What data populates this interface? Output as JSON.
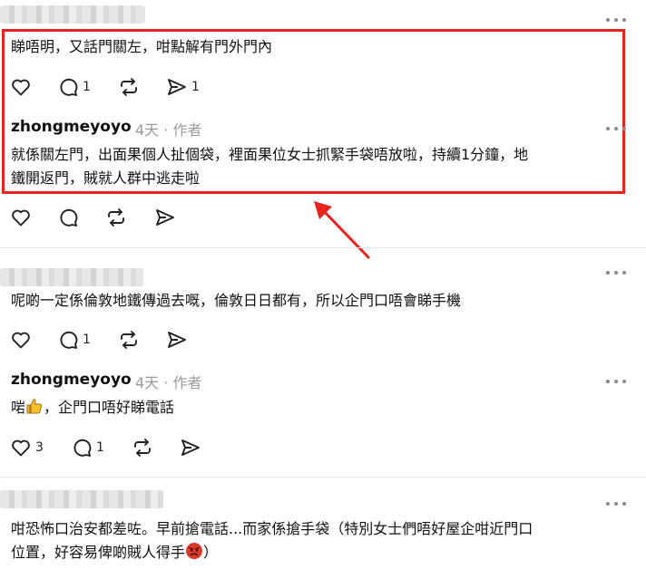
{
  "colors": {
    "highlight": "#e8221c",
    "arrow": "#e8221c",
    "icon": "#222222",
    "meta": "#9a9a9a"
  },
  "icons": {
    "like": "heart-icon",
    "reply": "comment-icon",
    "repost": "repost-icon",
    "share": "send-icon",
    "more": "more-dots-icon"
  },
  "thread1": {
    "reply1": {
      "text": "睇唔明，又話門關左，咁點解有門外門內",
      "reply_count": "1"
    },
    "reply2": {
      "author": "zhongmeyoyo",
      "time": "4天",
      "separator": "·",
      "role": "作者",
      "text_line1": "就係關左門，出面果個人扯個袋，裡面果位女士抓緊手袋唔放啦，持續1分鐘，地",
      "text_line2": "鐵開返門，賊就人群中逃走啦"
    }
  },
  "thread2": {
    "reply1": {
      "text": "呢啲一定係倫敦地鐵傳過去嘅，倫敦日日都有，所以企門口唔會睇手機",
      "reply_count": "1"
    },
    "reply2": {
      "author": "zhongmeyoyo",
      "time": "4天",
      "separator": "·",
      "role": "作者",
      "text_before": "啱",
      "text_after": "，企門口唔好睇電話",
      "like_count": "3",
      "reply_count": "1"
    }
  },
  "thread3": {
    "reply1": {
      "text_line1": "咁恐怖口治安都差咗。早前搶電話...而家係搶手袋（特別女士們唔好屋企咁近門口",
      "text_line2_before": "位置，好容易俾啲賊人得手",
      "text_line2_after": "）"
    }
  }
}
